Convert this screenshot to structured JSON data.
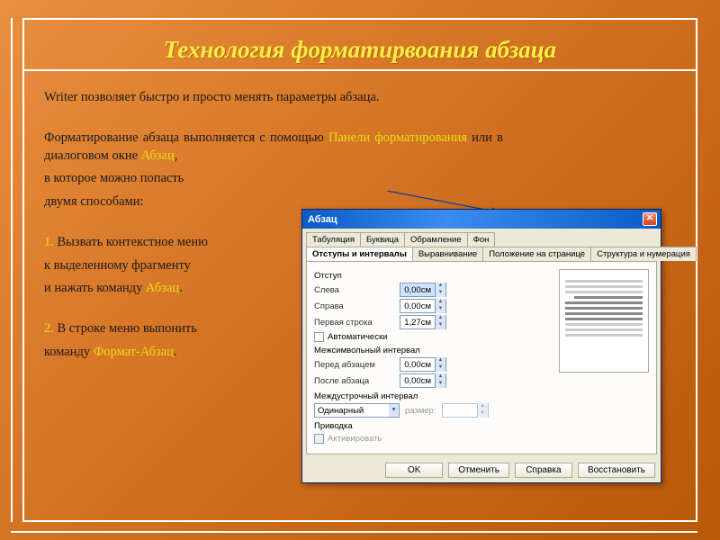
{
  "slide": {
    "title": "Технология форматирвоания абзаца",
    "p1": "Writer позволяет быстро и просто менять параметры абзаца.",
    "p2a": "Форматирование абзаца выполняется с помощью ",
    "p2b": "Панели форматирования",
    "p2c": " или в диалоговом окне ",
    "p2d": "Абзац",
    "p2e": ",",
    "p3": "в которое можно попасть",
    "p4": "двумя способами:",
    "s1n": "1.",
    "s1a": " Вызвать контекстное меню",
    "s1b": "к выделенному фрагменту",
    "s1c": "и нажать команду ",
    "s1d": "Абзац",
    "s1e": ".",
    "s2n": "2.",
    "s2a": " В строке меню выпонить",
    "s2b": " команду ",
    "s2c": "Формат-Абзац",
    "s2d": "."
  },
  "dialog": {
    "title": "Абзац",
    "tabs_row1": [
      "Табуляция",
      "Буквица",
      "Обрамление",
      "Фон"
    ],
    "tabs_row2": [
      "Отступы и интервалы",
      "Выравнивание",
      "Положение на странице",
      "Структура и нумерация"
    ],
    "active_tab": "Отступы и интервалы",
    "sections": {
      "indent": "Отступ",
      "left": "Слева",
      "right": "Справа",
      "first": "Первая строка",
      "auto": "Автоматически",
      "spacing": "Межсимвольный интервал",
      "before": "Перед абзацем",
      "after": "После абзаца",
      "line": "Междустрочный интервал",
      "line_select": "Одинарный",
      "size_label": "размер:",
      "register": "Приводка",
      "activate": "Активировать"
    },
    "values": {
      "left": "0,00см",
      "right": "0,00см",
      "first": "1,27см",
      "before": "0,00см",
      "after": "0,00см"
    },
    "buttons": {
      "ok": "OK",
      "cancel": "Отменить",
      "help": "Справка",
      "reset": "Восстановить"
    }
  }
}
